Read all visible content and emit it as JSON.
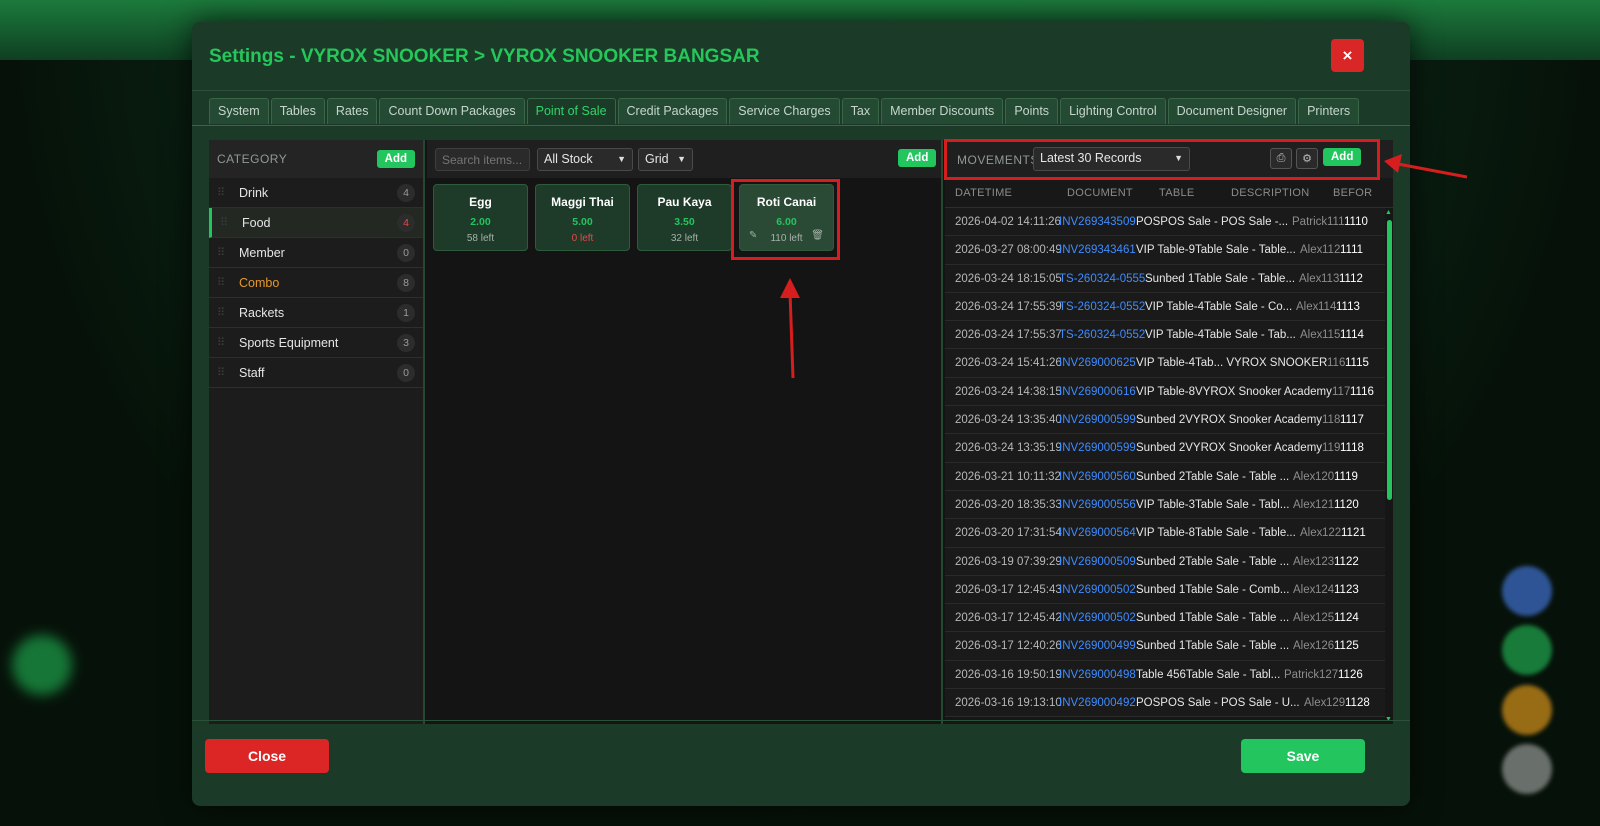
{
  "modal": {
    "title": "Settings - VYROX SNOOKER > VYROX SNOOKER BANGSAR",
    "close_x": "×",
    "tabs": [
      "System",
      "Tables",
      "Rates",
      "Count Down Packages",
      "Point of Sale",
      "Credit Packages",
      "Service Charges",
      "Tax",
      "Member Discounts",
      "Points",
      "Lighting Control",
      "Document Designer",
      "Printers"
    ],
    "active_tab": "Point of Sale"
  },
  "category": {
    "header": "CATEGORY",
    "add_label": "Add",
    "items": [
      {
        "label": "Drink",
        "count": "4"
      },
      {
        "label": "Food",
        "count": "4"
      },
      {
        "label": "Member",
        "count": "0"
      },
      {
        "label": "Combo",
        "count": "8"
      },
      {
        "label": "Rackets",
        "count": "1"
      },
      {
        "label": "Sports Equipment",
        "count": "3"
      },
      {
        "label": "Staff",
        "count": "0"
      }
    ]
  },
  "items_panel": {
    "search_placeholder": "Search items...",
    "stock_filter": "All Stock",
    "view_mode": "Grid",
    "add_label": "Add",
    "cards": [
      {
        "name": "Egg",
        "price": "2.00",
        "left": "58 left"
      },
      {
        "name": "Maggi Thai",
        "price": "5.00",
        "left": "0 left"
      },
      {
        "name": "Pau Kaya",
        "price": "3.50",
        "left": "32 left"
      },
      {
        "name": "Roti Canai",
        "price": "6.00",
        "left": "110 left"
      }
    ]
  },
  "movements": {
    "header": "MOVEMENTS",
    "range": "Latest 30 Records",
    "add_label": "Add",
    "columns": [
      "DATETIME",
      "DOCUMENT",
      "TABLE",
      "DESCRIPTION",
      "BEFOR"
    ],
    "rows": [
      {
        "dt": "2026-04-02 14:11:26",
        "doc": "INV269343509",
        "tbl": "POSPOS Sale - POS Sale -...",
        "user": "Patrick",
        "seq": "111",
        "bal": "1110"
      },
      {
        "dt": "2026-03-27 08:00:49",
        "doc": "INV269343461",
        "tbl": "VIP Table-9Table Sale - Table...",
        "user": "Alex",
        "seq": "112",
        "bal": "1111"
      },
      {
        "dt": "2026-03-24 18:15:05",
        "doc": "TS-260324-0555",
        "tbl": "Sunbed 1Table Sale - Table...",
        "user": "Alex",
        "seq": "113",
        "bal": "1112"
      },
      {
        "dt": "2026-03-24 17:55:39",
        "doc": "TS-260324-0552",
        "tbl": "VIP Table-4Table Sale - Co...",
        "user": "Alex",
        "seq": "114",
        "bal": "1113"
      },
      {
        "dt": "2026-03-24 17:55:37",
        "doc": "TS-260324-0552",
        "tbl": "VIP Table-4Table Sale - Tab...",
        "user": "Alex",
        "seq": "115",
        "bal": "1114"
      },
      {
        "dt": "2026-03-24 15:41:26",
        "doc": "INV269000625",
        "tbl": "VIP Table-4Tab... VYROX SNOOKER",
        "user": "",
        "seq": "116",
        "bal": "1115"
      },
      {
        "dt": "2026-03-24 14:38:15",
        "doc": "INV269000616",
        "tbl": "VIP Table-8VYROX Snooker Academy",
        "user": "",
        "seq": "117",
        "bal": "1116"
      },
      {
        "dt": "2026-03-24 13:35:40",
        "doc": "INV269000599",
        "tbl": "Sunbed 2VYROX Snooker Academy",
        "user": "",
        "seq": "118",
        "bal": "1117"
      },
      {
        "dt": "2026-03-24 13:35:19",
        "doc": "INV269000599",
        "tbl": "Sunbed 2VYROX Snooker Academy",
        "user": "",
        "seq": "119",
        "bal": "1118"
      },
      {
        "dt": "2026-03-21 10:11:32",
        "doc": "INV269000560",
        "tbl": "Sunbed 2Table Sale - Table ...",
        "user": "Alex",
        "seq": "120",
        "bal": "1119"
      },
      {
        "dt": "2026-03-20 18:35:33",
        "doc": "INV269000556",
        "tbl": "VIP Table-3Table Sale - Tabl...",
        "user": "Alex",
        "seq": "121",
        "bal": "1120"
      },
      {
        "dt": "2026-03-20 17:31:54",
        "doc": "INV269000564",
        "tbl": "VIP Table-8Table Sale - Table...",
        "user": "Alex",
        "seq": "122",
        "bal": "1121"
      },
      {
        "dt": "2026-03-19 07:39:29",
        "doc": "INV269000509",
        "tbl": "Sunbed 2Table Sale - Table ...",
        "user": "Alex",
        "seq": "123",
        "bal": "1122"
      },
      {
        "dt": "2026-03-17 12:45:43",
        "doc": "INV269000502",
        "tbl": "Sunbed 1Table Sale - Comb...",
        "user": "Alex",
        "seq": "124",
        "bal": "1123"
      },
      {
        "dt": "2026-03-17 12:45:42",
        "doc": "INV269000502",
        "tbl": "Sunbed 1Table Sale - Table ...",
        "user": "Alex",
        "seq": "125",
        "bal": "1124"
      },
      {
        "dt": "2026-03-17 12:40:26",
        "doc": "INV269000499",
        "tbl": "Sunbed 1Table Sale - Table ...",
        "user": "Alex",
        "seq": "126",
        "bal": "1125"
      },
      {
        "dt": "2026-03-16 19:50:19",
        "doc": "INV269000498",
        "tbl": "Table 456Table Sale - Tabl...",
        "user": "Patrick",
        "seq": "127",
        "bal": "1126"
      },
      {
        "dt": "2026-03-16 19:13:10",
        "doc": "INV269000492",
        "tbl": "POSPOS Sale - POS Sale - U...",
        "user": "Alex",
        "seq": "129",
        "bal": "1128"
      }
    ]
  },
  "footer": {
    "close_label": "Close",
    "save_label": "Save"
  },
  "colors": {
    "accent": "#22c55e",
    "danger": "#dc2626",
    "link": "#3f8cff",
    "annotation": "#d71e1e"
  }
}
